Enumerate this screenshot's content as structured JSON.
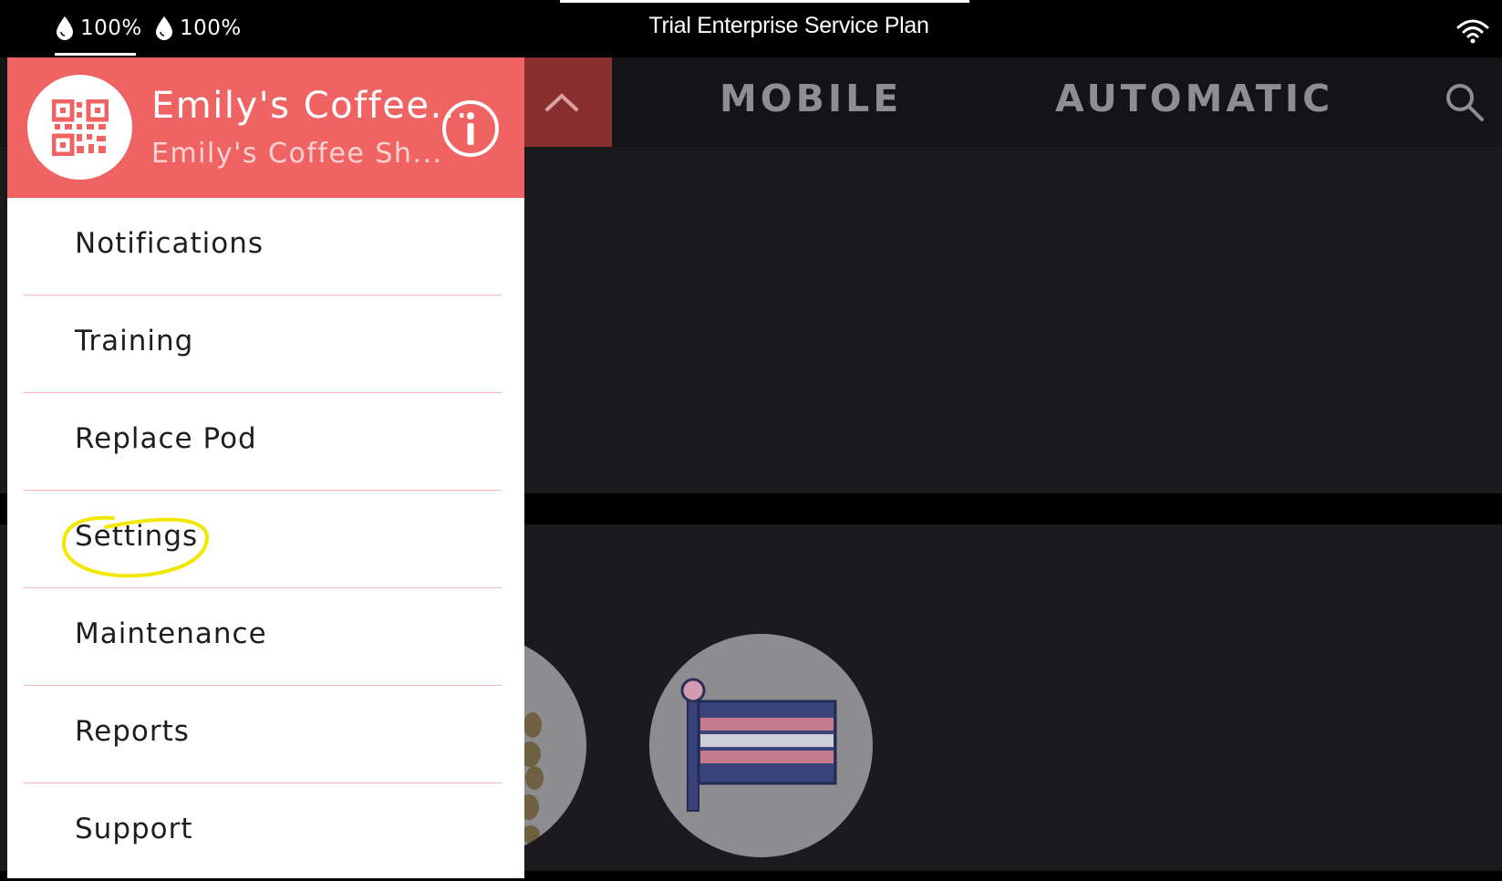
{
  "status": {
    "fill_levels": [
      {
        "value": "100%",
        "icon": "water-drop-icon"
      },
      {
        "value": "100%",
        "icon": "water-drop-icon"
      }
    ],
    "plan_title": "Trial Enterprise Service Plan",
    "wifi_icon": "wifi-icon"
  },
  "tabs": {
    "mobile": "MOBILE",
    "automatic": "AUTOMATIC"
  },
  "drawer": {
    "account_name": "Emily's Coffee...",
    "account_subtitle": "Emily's Coffee Sh...",
    "avatar_icon": "qr-code-icon",
    "info_icon": "info-icon",
    "menu": [
      {
        "label": "Notifications"
      },
      {
        "label": "Training"
      },
      {
        "label": "Replace Pod"
      },
      {
        "label": "Settings",
        "highlighted": true
      },
      {
        "label": "Maintenance"
      },
      {
        "label": "Reports"
      },
      {
        "label": "Support"
      }
    ]
  },
  "colors": {
    "drawer_header": "#ef6362",
    "menu_divider": "#f6b7bf",
    "highlight_annotation": "#f3e600",
    "tab_text": "#8e8e92",
    "collapse_tab": "#8a2f2f"
  }
}
